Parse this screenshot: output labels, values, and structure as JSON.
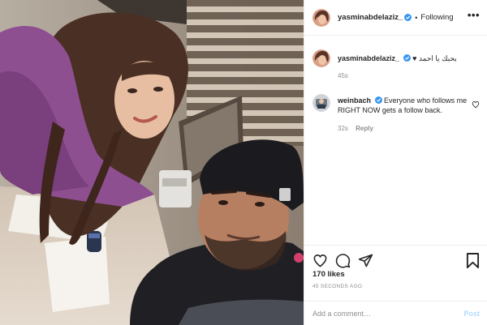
{
  "header": {
    "username": "yasminabdelaziz_",
    "separator": "•",
    "follow_label": "Following",
    "more_icon": "more-horizontal-icon"
  },
  "comments": [
    {
      "username": "yasminabdelaziz_",
      "text": "♥ بحبك يا احمد",
      "time": "45s",
      "verified": true
    },
    {
      "username": "weinbach",
      "text": "Everyone who follows me RIGHT NOW gets a follow back.",
      "time": "32s",
      "reply_label": "Reply",
      "verified": true
    }
  ],
  "actions": {
    "icons": [
      "heart-icon",
      "comment-icon",
      "share-icon",
      "bookmark-icon"
    ]
  },
  "likes": "170 likes",
  "posted": "45 SECONDS AGO",
  "add_comment": {
    "placeholder": "Add a comment…",
    "post_label": "Post"
  },
  "colors": {
    "verified": "#3897f0",
    "text": "#262626",
    "muted": "#8e8e8e",
    "post_disabled": "#b3dbff",
    "border": "#efefef"
  }
}
